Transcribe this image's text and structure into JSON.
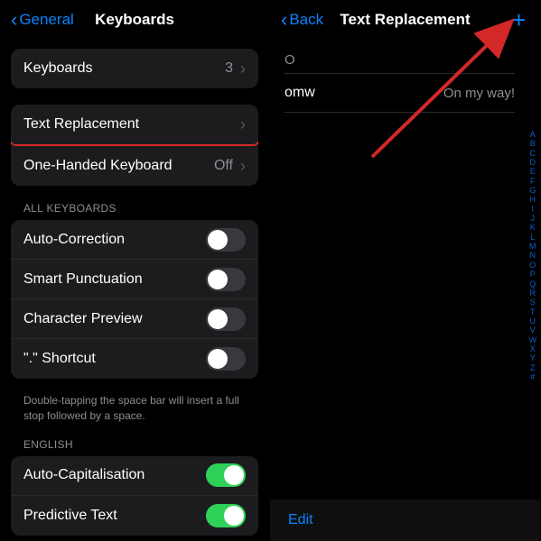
{
  "left": {
    "nav": {
      "back_label": "General",
      "title": "Keyboards"
    },
    "group1": {
      "keyboards": {
        "label": "Keyboards",
        "value": "3"
      }
    },
    "group2": {
      "text_replacement": {
        "label": "Text Replacement"
      },
      "one_handed": {
        "label": "One-Handed Keyboard",
        "value": "Off"
      }
    },
    "section_all": "ALL KEYBOARDS",
    "group3": {
      "auto_correction": {
        "label": "Auto-Correction"
      },
      "smart_punctuation": {
        "label": "Smart Punctuation"
      },
      "character_preview": {
        "label": "Character Preview"
      },
      "dot_shortcut": {
        "label": "\".\" Shortcut"
      }
    },
    "footer": "Double-tapping the space bar will insert a full stop followed by a space.",
    "section_english": "ENGLISH",
    "group4": {
      "auto_cap": {
        "label": "Auto-Capitalisation"
      },
      "predictive": {
        "label": "Predictive Text"
      }
    }
  },
  "right": {
    "nav": {
      "back_label": "Back",
      "title": "Text Replacement"
    },
    "section_letter": "O",
    "item": {
      "phrase": "omw",
      "shortcut": "On my way!"
    },
    "edit_label": "Edit",
    "index": [
      "A",
      "B",
      "C",
      "D",
      "E",
      "F",
      "G",
      "H",
      "I",
      "J",
      "K",
      "L",
      "M",
      "N",
      "O",
      "P",
      "Q",
      "R",
      "S",
      "T",
      "U",
      "V",
      "W",
      "X",
      "Y",
      "Z",
      "#"
    ]
  }
}
